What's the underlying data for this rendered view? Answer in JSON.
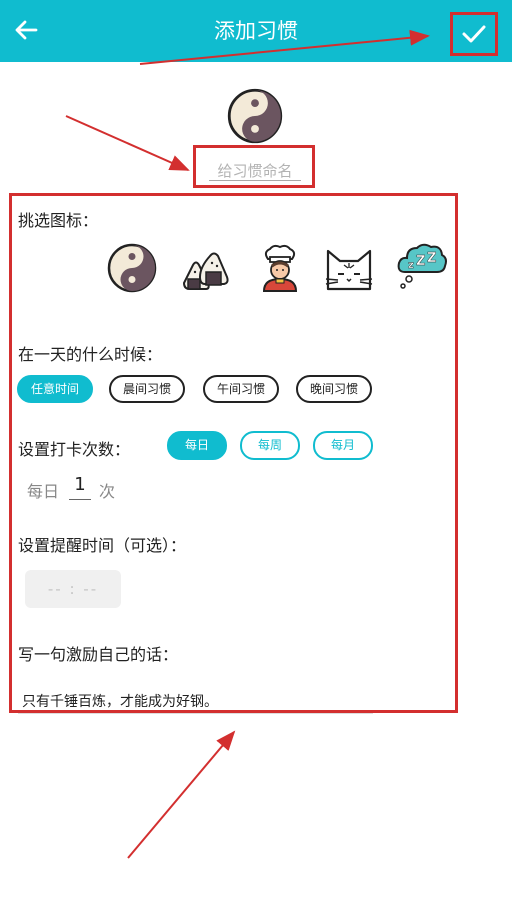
{
  "header": {
    "title": "添加习惯",
    "bg_color": "#10bccf"
  },
  "name_field": {
    "placeholder": "给习惯命名",
    "value": ""
  },
  "icon_section": {
    "label": "挑选图标：",
    "icons": [
      "yin-yang-icon",
      "onigiri-icon",
      "chef-icon",
      "cat-icon",
      "sleep-cloud-icon"
    ]
  },
  "time_of_day": {
    "label": "在一天的什么时候：",
    "options": [
      "任意时间",
      "晨间习惯",
      "午间习惯",
      "晚间习惯"
    ],
    "selected": "任意时间"
  },
  "frequency": {
    "label": "设置打卡次数：",
    "options": [
      "每日",
      "每周",
      "每月"
    ],
    "selected": "每日",
    "prefix": "每日",
    "count": "1",
    "suffix": "次"
  },
  "reminder": {
    "label": "设置提醒时间（可选）：",
    "value": "-- : --"
  },
  "motto": {
    "label": "写一句激励自己的话：",
    "value": "只有千锤百炼，才能成为好钢。"
  },
  "annotation_color": "#d32f2f"
}
